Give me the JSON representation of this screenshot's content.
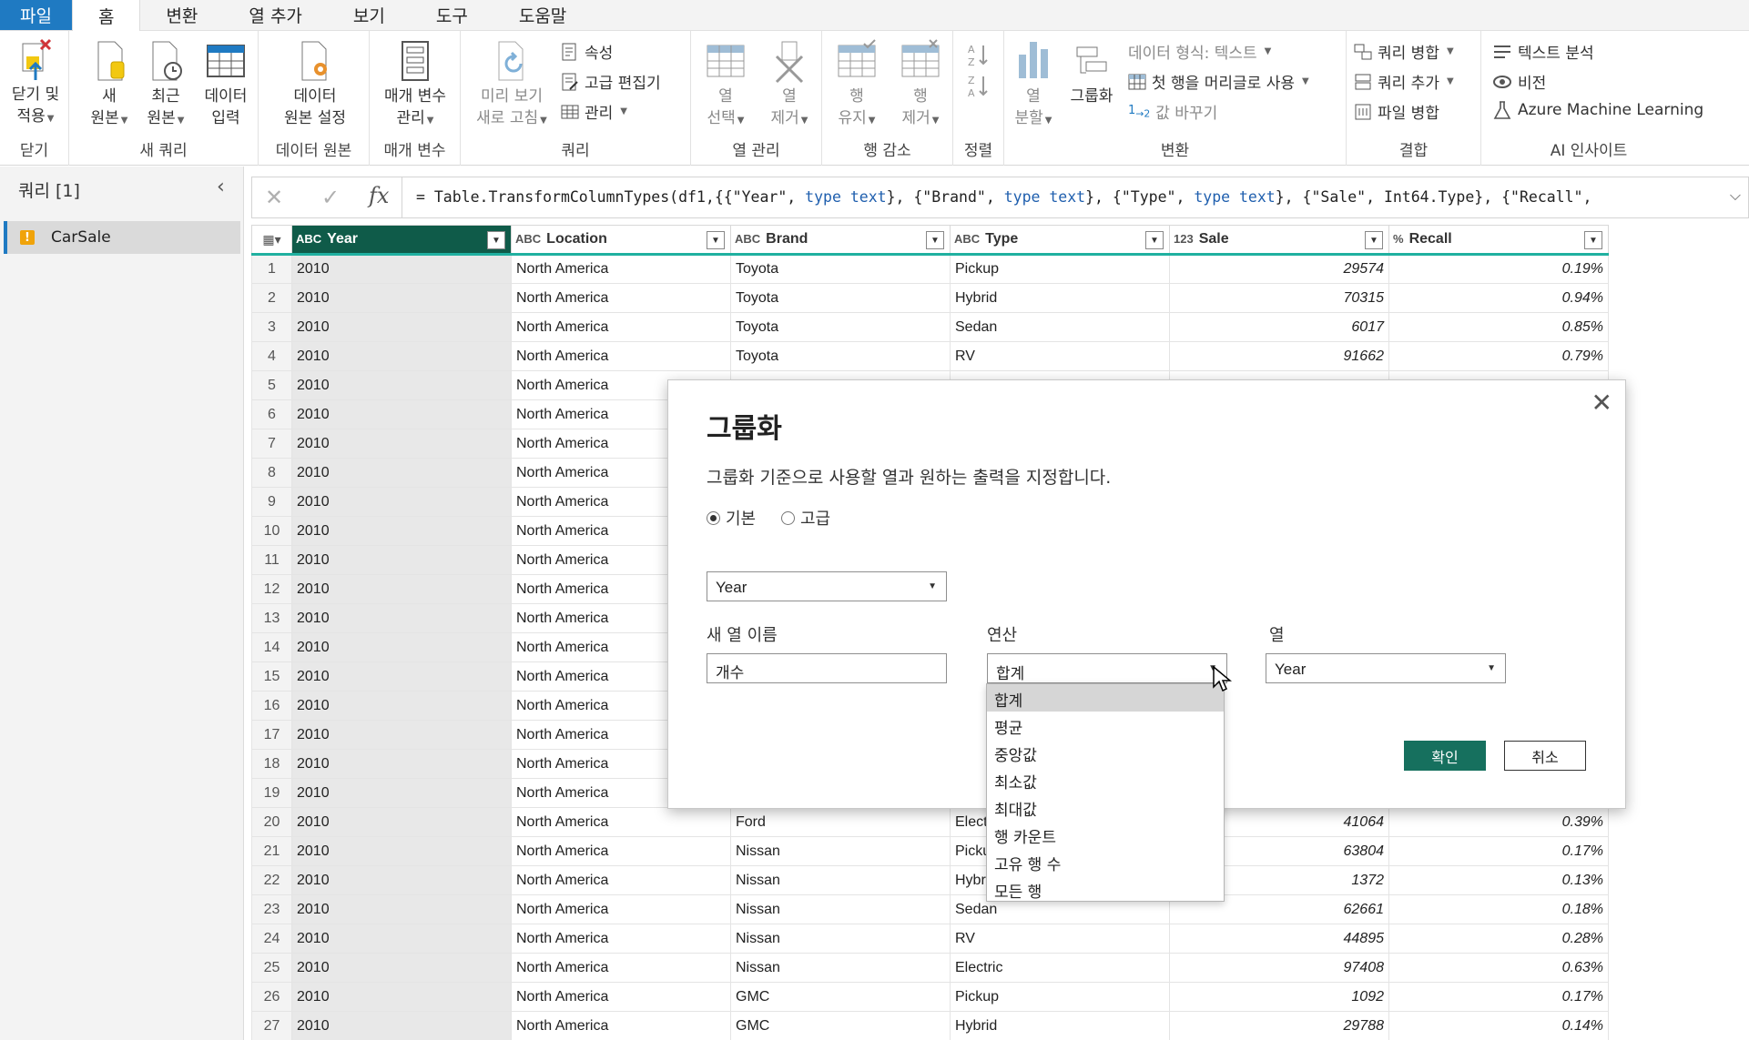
{
  "tabs": [
    "파일",
    "홈",
    "변환",
    "열 추가",
    "보기",
    "도구",
    "도움말"
  ],
  "ribbon": {
    "close_apply": [
      "닫기 및",
      "적용"
    ],
    "new_source": [
      "새",
      "원본"
    ],
    "recent_source": [
      "최근",
      "원본"
    ],
    "enter_data": [
      "데이터",
      "입력"
    ],
    "ds_settings": [
      "데이터",
      "원본 설정"
    ],
    "manage_params": [
      "매개 변수",
      "관리"
    ],
    "refresh_preview": [
      "미리 보기",
      "새로 고침"
    ],
    "properties": "속성",
    "advanced_editor": "고급 편집기",
    "manage": "관리",
    "choose_cols": [
      "열",
      "선택"
    ],
    "remove_cols": [
      "열",
      "제거"
    ],
    "keep_rows": [
      "행",
      "유지"
    ],
    "remove_rows": [
      "행",
      "제거"
    ],
    "split_col": [
      "열",
      "분할"
    ],
    "group_by": "그룹화",
    "data_type": "데이터 형식: 텍스트",
    "first_row_header": "첫 행을 머리글로 사용",
    "replace_values": "값 바꾸기",
    "merge_queries": "쿼리 병합",
    "append_queries": "쿼리 추가",
    "combine_files": "파일 병합",
    "text_analytics": "텍스트 분석",
    "vision": "비전",
    "azure_ml": "Azure Machine Learning",
    "groups": {
      "close": "닫기",
      "new_query": "새 쿼리",
      "data_source": "데이터 원본",
      "parameters": "매개 변수",
      "query": "쿼리",
      "manage_cols": "열 관리",
      "reduce_rows": "행 감소",
      "sort": "정렬",
      "transform": "변환",
      "combine": "결합",
      "ai": "AI 인사이트"
    }
  },
  "queries": {
    "header": "쿼리 [1]",
    "items": [
      "CarSale"
    ]
  },
  "formula": {
    "prefix": "= Table.TransformColumnTypes(df1,{{\"Year\", ",
    "k1": "type text",
    "s2": "}, {\"Brand\", ",
    "k2": "type text",
    "s3": "}, {\"Type\", ",
    "k3": "type text",
    "s4": "}, {\"Sale\", Int64.Type}, {\"Recall\","
  },
  "grid": {
    "columns": [
      {
        "type": "ABC",
        "name": "Year"
      },
      {
        "type": "ABC",
        "name": "Location"
      },
      {
        "type": "ABC",
        "name": "Brand"
      },
      {
        "type": "ABC",
        "name": "Type"
      },
      {
        "type": "123",
        "name": "Sale"
      },
      {
        "type": "%",
        "name": "Recall"
      }
    ],
    "rows": [
      [
        "1",
        "2010",
        "North America",
        "Toyota",
        "Pickup",
        "29574",
        "0.19%"
      ],
      [
        "2",
        "2010",
        "North America",
        "Toyota",
        "Hybrid",
        "70315",
        "0.94%"
      ],
      [
        "3",
        "2010",
        "North America",
        "Toyota",
        "Sedan",
        "6017",
        "0.85%"
      ],
      [
        "4",
        "2010",
        "North America",
        "Toyota",
        "RV",
        "91662",
        "0.79%"
      ],
      [
        "5",
        "2010",
        "North America",
        "",
        "",
        "",
        ""
      ],
      [
        "6",
        "2010",
        "North America",
        "",
        "",
        "",
        ""
      ],
      [
        "7",
        "2010",
        "North America",
        "",
        "",
        "",
        ""
      ],
      [
        "8",
        "2010",
        "North America",
        "",
        "",
        "",
        ""
      ],
      [
        "9",
        "2010",
        "North America",
        "",
        "",
        "",
        ""
      ],
      [
        "10",
        "2010",
        "North America",
        "",
        "",
        "",
        ""
      ],
      [
        "11",
        "2010",
        "North America",
        "",
        "",
        "",
        ""
      ],
      [
        "12",
        "2010",
        "North America",
        "",
        "",
        "",
        ""
      ],
      [
        "13",
        "2010",
        "North America",
        "",
        "",
        "",
        ""
      ],
      [
        "14",
        "2010",
        "North America",
        "",
        "",
        "",
        ""
      ],
      [
        "15",
        "2010",
        "North America",
        "",
        "",
        "",
        ""
      ],
      [
        "16",
        "2010",
        "North America",
        "",
        "",
        "",
        ""
      ],
      [
        "17",
        "2010",
        "North America",
        "",
        "",
        "",
        ""
      ],
      [
        "18",
        "2010",
        "North America",
        "",
        "",
        "",
        ""
      ],
      [
        "19",
        "2010",
        "North America",
        "",
        "",
        "",
        ""
      ],
      [
        "20",
        "2010",
        "North America",
        "Ford",
        "Elect",
        "41064",
        "0.39%"
      ],
      [
        "21",
        "2010",
        "North America",
        "Nissan",
        "Picku",
        "63804",
        "0.17%"
      ],
      [
        "22",
        "2010",
        "North America",
        "Nissan",
        "Hybr",
        "1372",
        "0.13%"
      ],
      [
        "23",
        "2010",
        "North America",
        "Nissan",
        "Sedan",
        "62661",
        "0.18%"
      ],
      [
        "24",
        "2010",
        "North America",
        "Nissan",
        "RV",
        "44895",
        "0.28%"
      ],
      [
        "25",
        "2010",
        "North America",
        "Nissan",
        "Electric",
        "97408",
        "0.63%"
      ],
      [
        "26",
        "2010",
        "North America",
        "GMC",
        "Pickup",
        "1092",
        "0.17%"
      ],
      [
        "27",
        "2010",
        "North America",
        "GMC",
        "Hybrid",
        "29788",
        "0.14%"
      ]
    ]
  },
  "dialog": {
    "title": "그룹화",
    "description": "그룹화 기준으로 사용할 열과 원하는 출력을 지정합니다.",
    "radio_basic": "기본",
    "radio_advanced": "고급",
    "groupby_value": "Year",
    "new_col_label": "새 열 이름",
    "new_col_value": "개수",
    "operation_label": "연산",
    "operation_value": "합계",
    "column_label": "열",
    "column_value": "Year",
    "ok": "확인",
    "cancel": "취소",
    "operation_options": [
      "합계",
      "평균",
      "중앙값",
      "최소값",
      "최대값",
      "행 카운트",
      "고유 행 수",
      "모든 행"
    ]
  },
  "colors": {
    "file_tab": "#1f7ac2",
    "selected_header": "#0f5b49",
    "ok_button": "#16705e",
    "header_underline": "#20b0a0"
  }
}
